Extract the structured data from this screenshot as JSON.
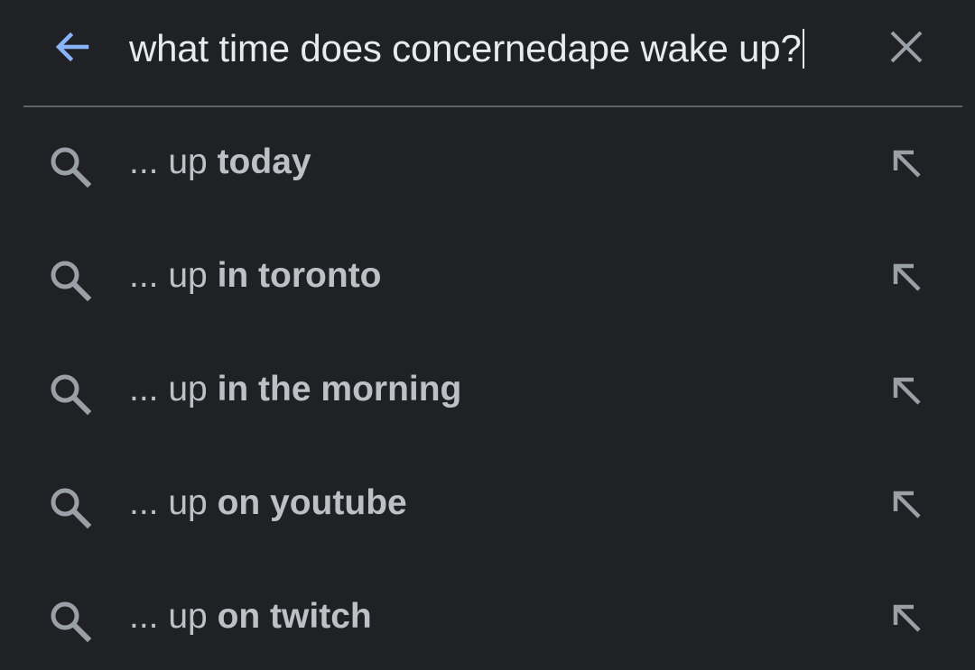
{
  "search": {
    "query": "what time does concernedape wake up?",
    "back_icon": "arrow-left-icon",
    "clear_icon": "close-icon"
  },
  "colors": {
    "background": "#202124",
    "accent": "#8ab4f8",
    "text": "#e8eaed",
    "secondary_text": "#bdc1c6",
    "icon": "#9aa0a6"
  },
  "suggestions": [
    {
      "prefix": "... up ",
      "completion": "today",
      "icon": "search-icon",
      "action_icon": "arrow-up-left-icon"
    },
    {
      "prefix": "... up ",
      "completion": "in toronto",
      "icon": "search-icon",
      "action_icon": "arrow-up-left-icon"
    },
    {
      "prefix": "... up ",
      "completion": "in the morning",
      "icon": "search-icon",
      "action_icon": "arrow-up-left-icon"
    },
    {
      "prefix": "... up ",
      "completion": "on youtube",
      "icon": "search-icon",
      "action_icon": "arrow-up-left-icon"
    },
    {
      "prefix": "... up ",
      "completion": "on twitch",
      "icon": "search-icon",
      "action_icon": "arrow-up-left-icon"
    }
  ]
}
